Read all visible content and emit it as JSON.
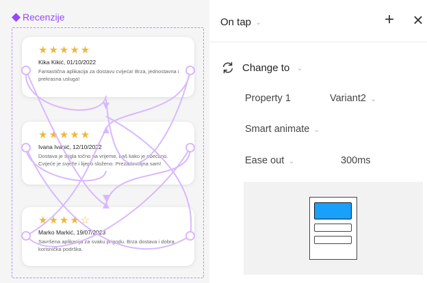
{
  "canvas": {
    "frame_name": "Recenzije",
    "reviews": [
      {
        "stars": "★★★★★",
        "reviewer": "Kika Kikić, 01/10/2022",
        "text": "Fantastična aplikacija za dostavu cvijeća! Brza, jednostavna i prekrasna usluga!"
      },
      {
        "stars": "★★★★★",
        "reviewer": "Ivana Ivanić, 12/10/2022",
        "text": "Dostava je stigla točno na vrijeme, baš kako je obećano. Cvijeće je svježe i lijepo složeno. Prezadovoljna sam!"
      },
      {
        "stars": "★★★★☆",
        "rating": 4,
        "reviewer": "Marko Markić, 19/07/2023",
        "text": "Savršena aplikacija za svaku prigodu. Brza dostava i dobra korisnička podrška."
      }
    ]
  },
  "panel": {
    "trigger": "On tap",
    "action": "Change to",
    "property_label": "Property 1",
    "property_value": "Variant2",
    "animation": "Smart animate",
    "easing": "Ease out",
    "duration": "300ms",
    "colors": {
      "accent": "#9747ff",
      "preview_blue": "#18a0fb",
      "star": "#f0b63a"
    }
  }
}
